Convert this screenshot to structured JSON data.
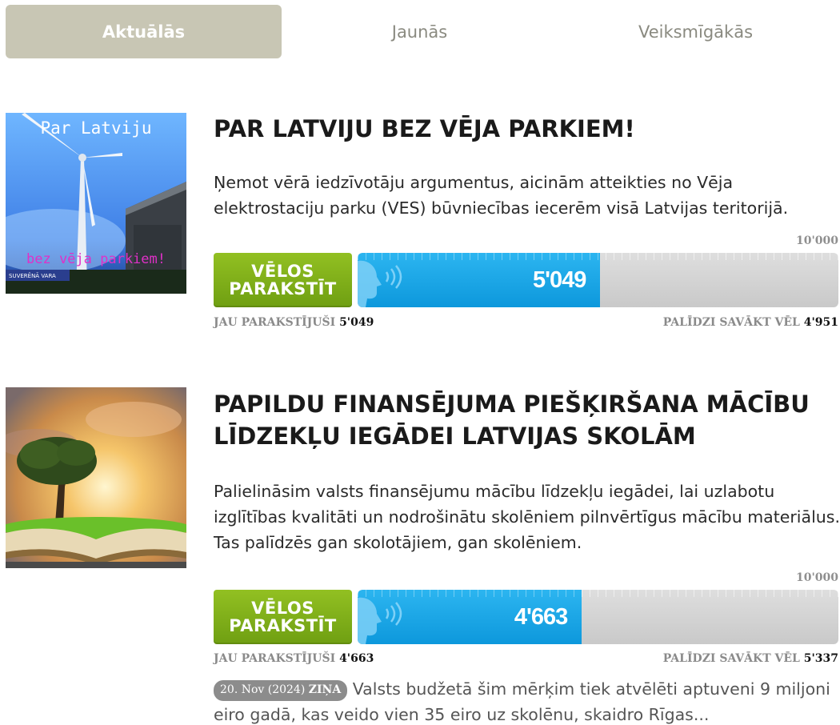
{
  "tabs": [
    {
      "label": "Aktuālās",
      "active": true
    },
    {
      "label": "Jaunās",
      "active": false
    },
    {
      "label": "Veiksmīgākās",
      "active": false
    }
  ],
  "petitions": [
    {
      "title": "PAR LATVIJU BEZ VĒJA PARKIEM!",
      "description": "Ņemot vērā iedzīvotāju argumentus, aicinām atteikties no Vēja elektrostaciju parku (VES) būvniecības iecerēm visā Latvijas teritorijā.",
      "goal": "10'000",
      "sign_line1": "VĒLOS",
      "sign_line2": "PARAKSTĪT",
      "count": "5'049",
      "progress": 0.5049,
      "signed_label": "JAU PARAKSTĪJUŠI",
      "signed_value": "5'049",
      "remaining_label": "PALĪDZI SAVĀKT VĒL",
      "remaining_value": "4'951",
      "image": {
        "top_text": "Par Latviju",
        "bottom_text": "bez vēja parkiem!",
        "corner_text": "SUVERĒNĀ VARA"
      }
    },
    {
      "title": "PAPILDU FINANSĒJUMA PIEŠĶIRŠANA MĀCĪBU LĪDZEKĻU IEGĀDEI LATVIJAS SKOLĀM",
      "description": "Palielināsim valsts finansējumu mācību līdzekļu iegādei, lai uzlabotu izglītības kvalitāti un nodrošinātu skolēniem pilnvērtīgus mācību materiālus. Tas palīdzēs gan skolotājiem, gan skolēniem.",
      "goal": "10'000",
      "sign_line1": "VĒLOS",
      "sign_line2": "PARAKSTĪT",
      "count": "4'663",
      "progress": 0.4663,
      "signed_label": "JAU PARAKSTĪJUŠI",
      "signed_value": "4'663",
      "remaining_label": "PALĪDZI SAVĀKT VĒL",
      "remaining_value": "5'337",
      "news": {
        "date": "20. Nov (2024)",
        "tag": "ZIŅA",
        "text": "Valsts budžetā šim mērķim tiek atvēlēti aptuveni 9 miljoni eiro gadā, kas veido vien 35 eiro uz skolēnu, skaidro Rīgas..."
      }
    }
  ],
  "colors": {
    "tab_active": "#c8c6b4",
    "sign_button": "#7fae17",
    "progress_fill": "#1aa6e6",
    "progress_track": "#d4d4d4"
  }
}
